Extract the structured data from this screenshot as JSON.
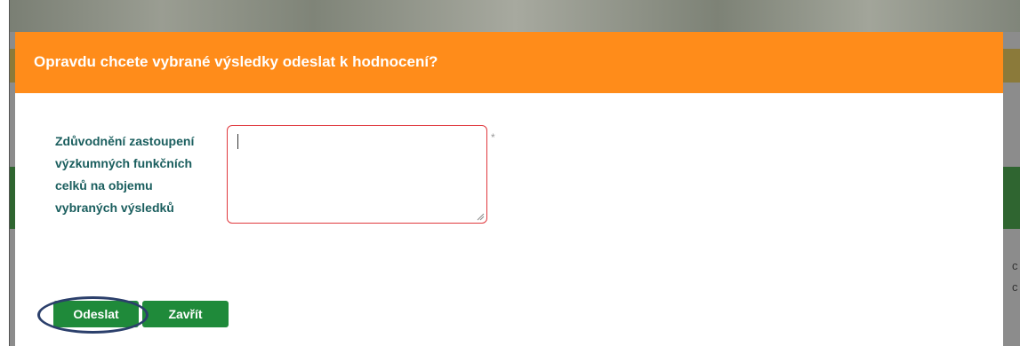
{
  "modal": {
    "title": "Opravdu chcete vybrané výsledky odeslat k hodnocení?",
    "field_label": "Zdůvodnění zastoupení výzkumných funkčních celků na objemu vybraných výsledků",
    "field_value": "",
    "required_marker": "*",
    "buttons": {
      "send_label": "Odeslat",
      "close_label": "Zavřít"
    }
  },
  "background": {
    "edge_text_1": "c",
    "edge_text_2": "c"
  },
  "colors": {
    "header": "#ff8c1a",
    "button": "#1f8a3a",
    "label": "#1a5e5e",
    "invalid_border": "#e0393e",
    "highlight_oval": "#2b3f6b"
  }
}
